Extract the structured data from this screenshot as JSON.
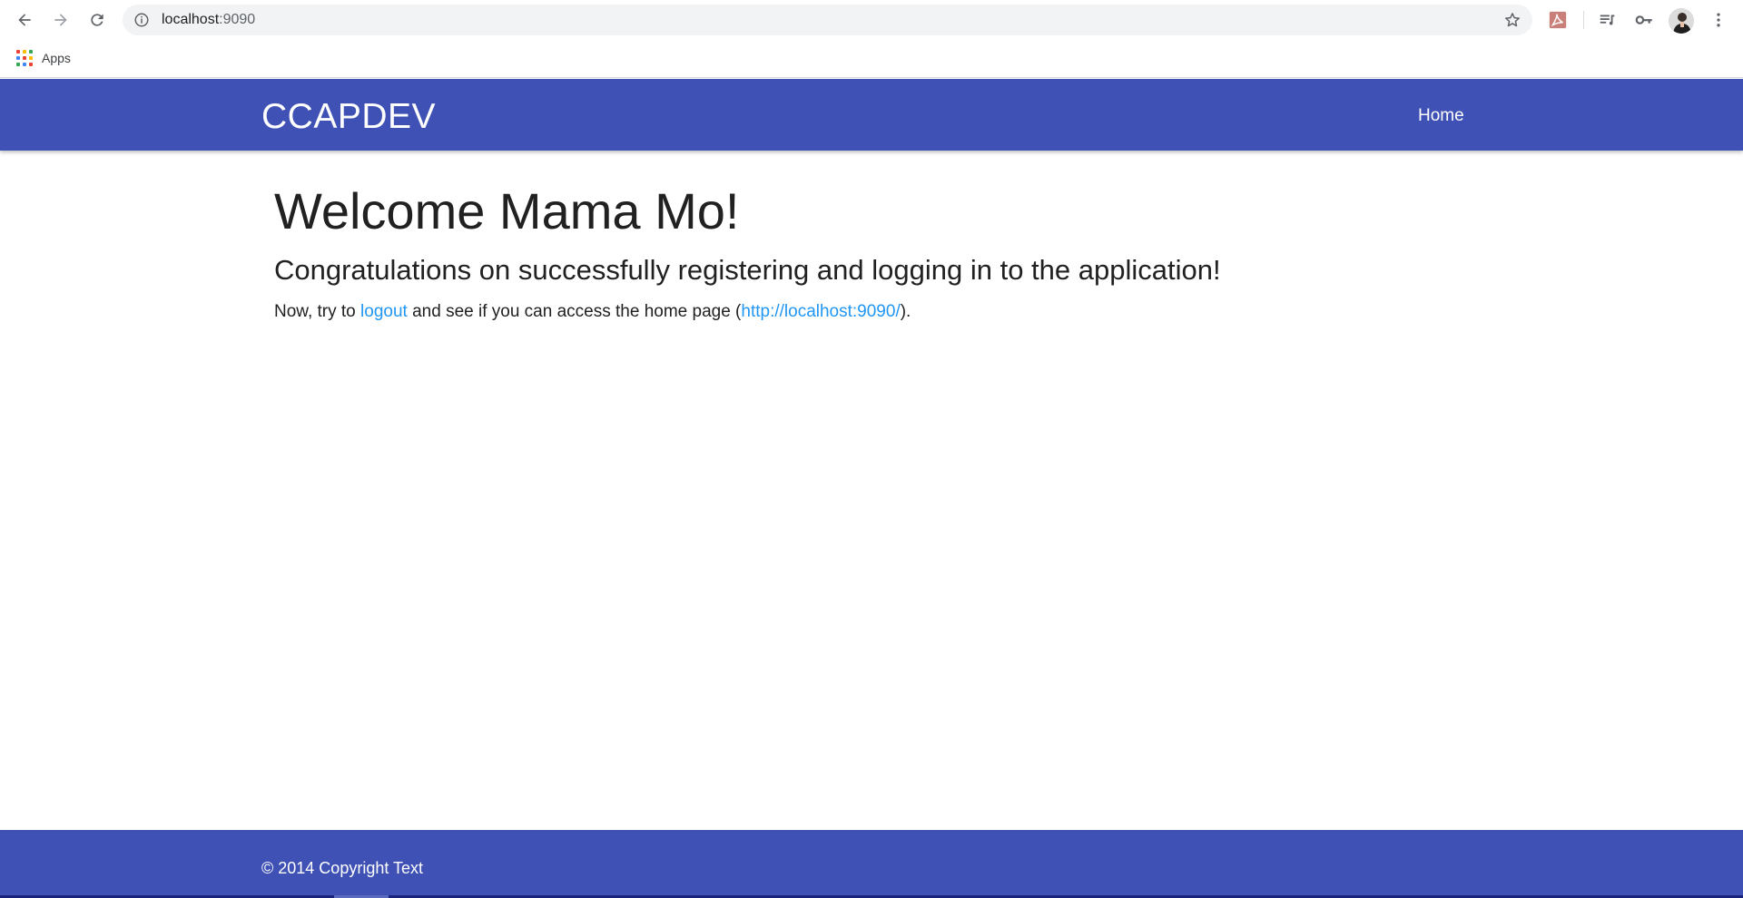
{
  "browser": {
    "url_host": "localhost",
    "url_port": ":9090",
    "bookmarks": {
      "apps_label": "Apps"
    },
    "icons": [
      "back-icon",
      "forward-icon",
      "reload-icon",
      "info-icon",
      "star-icon",
      "acrobat-extension-icon",
      "media-queue-icon",
      "key-icon",
      "profile-avatar",
      "menu-icon"
    ]
  },
  "navbar": {
    "brand": "CCAPDEV",
    "links": [
      {
        "label": "Home"
      }
    ],
    "color": "#3f51b5"
  },
  "main": {
    "welcome": "Welcome Mama Mo!",
    "congrats": "Congratulations on successfully registering and logging in to the application!",
    "lead": {
      "prefix": "Now, try to ",
      "logout_link": "logout",
      "middle": " and see if you can access the home page (",
      "home_link": "http://localhost:9090/",
      "suffix": ")."
    },
    "link_color": "#2196f3"
  },
  "footer": {
    "copyright": "© 2014 Copyright Text"
  }
}
